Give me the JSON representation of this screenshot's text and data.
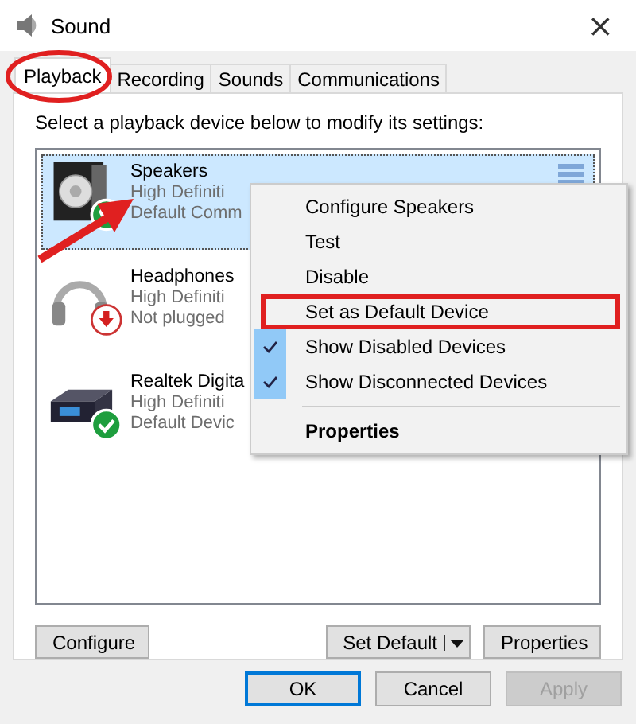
{
  "window": {
    "title": "Sound",
    "close": "×"
  },
  "tabs": [
    {
      "label": "Playback",
      "selected": true,
      "circled": true
    },
    {
      "label": "Recording",
      "selected": false,
      "circled": false
    },
    {
      "label": "Sounds",
      "selected": false,
      "circled": false
    },
    {
      "label": "Communications",
      "selected": false,
      "circled": false
    }
  ],
  "instruction": "Select a playback device below to modify its settings:",
  "devices": [
    {
      "name": "Speakers",
      "line_2": "High Definiti",
      "line_3": "Default Comm",
      "kind": "speaker",
      "default_device": false,
      "default_comm": true,
      "unplugged": false,
      "selected": true,
      "arrow_pointed": true
    },
    {
      "name": "Headphones",
      "line_2": "High Definiti",
      "line_3": "Not plugged",
      "kind": "headphones",
      "default_device": false,
      "default_comm": false,
      "unplugged": true,
      "selected": false,
      "arrow_pointed": false
    },
    {
      "name": "Realtek Digita",
      "line_2": "High Definiti",
      "line_3": "Default Devic",
      "kind": "digital",
      "default_device": true,
      "default_comm": false,
      "unplugged": false,
      "selected": false,
      "arrow_pointed": false
    }
  ],
  "context_menu": {
    "items": [
      {
        "kind": "item",
        "label": "Configure Speakers",
        "checked": false,
        "bold": false,
        "boxed": false
      },
      {
        "kind": "item",
        "label": "Test",
        "checked": false,
        "bold": false,
        "boxed": false
      },
      {
        "kind": "item",
        "label": "Disable",
        "checked": false,
        "bold": false,
        "boxed": false
      },
      {
        "kind": "item",
        "label": "Set as Default Device",
        "checked": false,
        "bold": false,
        "boxed": true
      },
      {
        "kind": "item",
        "label": "Show Disabled Devices",
        "checked": true,
        "bold": false,
        "boxed": false
      },
      {
        "kind": "item",
        "label": "Show Disconnected Devices",
        "checked": true,
        "bold": false,
        "boxed": false
      },
      {
        "kind": "separator"
      },
      {
        "kind": "item",
        "label": "Properties",
        "checked": false,
        "bold": true,
        "boxed": false
      }
    ]
  },
  "panel_buttons": {
    "configure": "Configure",
    "set_default": "Set Default",
    "properties": "Properties"
  },
  "dialog_buttons": [
    {
      "label": "OK",
      "kind": "default",
      "disabled": false
    },
    {
      "label": "Cancel",
      "kind": "normal",
      "disabled": false
    },
    {
      "label": "Apply",
      "kind": "normal",
      "disabled": true
    }
  ]
}
